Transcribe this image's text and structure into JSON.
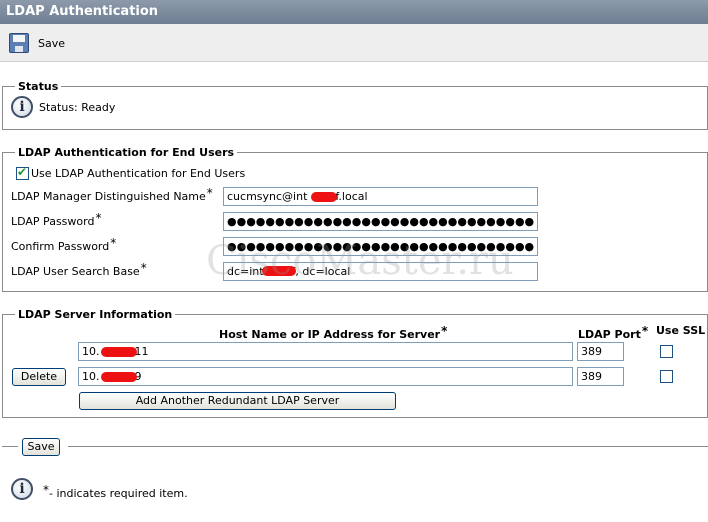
{
  "window": {
    "title": "LDAP Authentication"
  },
  "toolbar": {
    "save_label": "Save",
    "save_icon": "floppy-disk-icon"
  },
  "status": {
    "legend": "Status",
    "message": "Status: Ready",
    "icon": "info-icon"
  },
  "end_users": {
    "legend": "LDAP Authentication for End Users",
    "use_ldap_label": "Use LDAP Authentication for End Users",
    "use_ldap_checked": true,
    "manager_dn_label": "LDAP Manager Distinguished Name",
    "manager_dn_value": "cucmsync@int        f.local",
    "password_label": "LDAP Password",
    "password_value": "●●●●●●●●●●●●●●●●●●●●●●●●●●●●●●●●●●●●●●●●●●●●●●●●●●●",
    "confirm_label": "Confirm Password",
    "confirm_value": "●●●●●●●●●●●●●●●●●●●●●●●●●●●●●●●●●●●●●●●●●●●●●●●●●●●",
    "search_base_label": "LDAP User Search Base",
    "search_base_value": "dc=int        f, dc=local",
    "required_mark": "*"
  },
  "watermark": "CiscoMaster.ru",
  "servers": {
    "legend": "LDAP Server Information",
    "col_host": "Host Name or IP Address for Server",
    "col_port": "LDAP Port",
    "col_ssl": "Use SSL",
    "required_mark": "*",
    "rows": [
      {
        "host": "10.          11",
        "port": "389",
        "ssl": false
      },
      {
        "host": "10.          9",
        "port": "389",
        "ssl": false
      }
    ],
    "delete_label": "Delete",
    "add_label": "Add Another Redundant LDAP Server"
  },
  "footer": {
    "save_label": "Save",
    "required_mark": "*",
    "note": "- indicates required item."
  },
  "colors": {
    "title_bar": "#7b8a9e",
    "redaction": "#ee1111"
  }
}
